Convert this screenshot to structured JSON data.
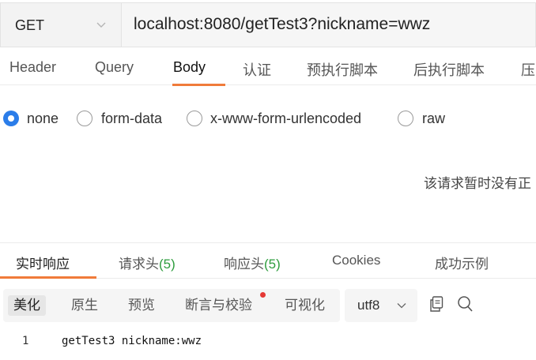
{
  "request": {
    "method": "GET",
    "url": "localhost:8080/getTest3?nickname=wwz"
  },
  "request_tabs": [
    {
      "label": "Header",
      "active": false
    },
    {
      "label": "Query",
      "active": false
    },
    {
      "label": "Body",
      "active": true
    },
    {
      "label": "认证",
      "active": false
    },
    {
      "label": "预执行脚本",
      "active": false
    },
    {
      "label": "后执行脚本",
      "active": false
    },
    {
      "label": "压",
      "active": false
    }
  ],
  "body_types": [
    {
      "label": "none",
      "checked": true
    },
    {
      "label": "form-data",
      "checked": false
    },
    {
      "label": "x-www-form-urlencoded",
      "checked": false
    },
    {
      "label": "raw",
      "checked": false
    }
  ],
  "body_empty_message": "该请求暂时没有正",
  "response_tabs": [
    {
      "label": "实时响应",
      "count": "",
      "active": true
    },
    {
      "label": "请求头",
      "count": "(5)",
      "active": false
    },
    {
      "label": "响应头",
      "count": "(5)",
      "active": false
    },
    {
      "label": "Cookies",
      "count": "",
      "active": false
    },
    {
      "label": "成功示例",
      "count": "",
      "active": false
    }
  ],
  "view_modes": [
    {
      "label": "美化",
      "active": true
    },
    {
      "label": "原生",
      "active": false
    },
    {
      "label": "预览",
      "active": false
    },
    {
      "label": "断言与校验",
      "active": false,
      "badge": true
    },
    {
      "label": "可视化",
      "active": false
    }
  ],
  "encoding": "utf8",
  "response_lines": [
    {
      "number": "1",
      "text": "getTest3 nickname:wwz"
    }
  ],
  "colors": {
    "accent": "#f07b3a",
    "radio_checked": "#2b7de9",
    "count_green": "#2e9d3e",
    "badge_red": "#e53935"
  },
  "icons": {
    "method_dropdown": "chevron-down-icon",
    "encoding_dropdown": "chevron-down-icon",
    "copy": "copy-icon",
    "search": "search-icon"
  }
}
